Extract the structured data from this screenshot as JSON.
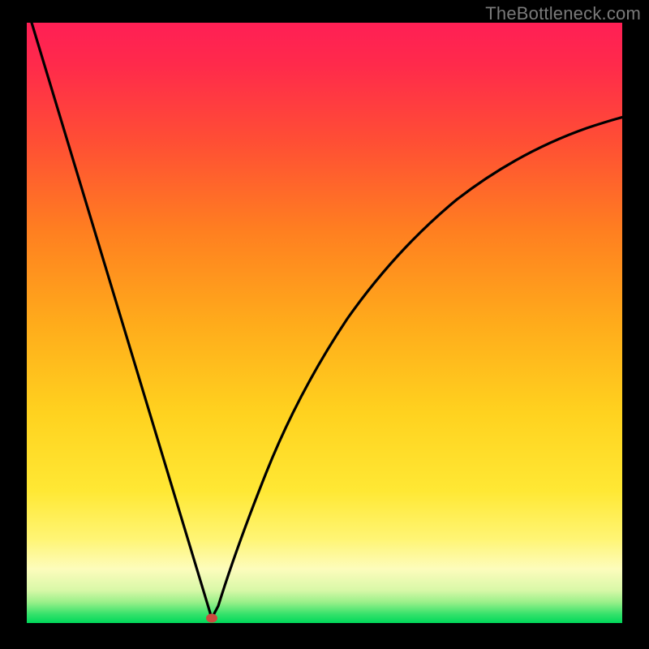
{
  "watermark": "TheBottleneck.com",
  "chart_data": {
    "type": "line",
    "title": "",
    "xlabel": "",
    "ylabel": "",
    "xlim": [
      0,
      100
    ],
    "ylim": [
      0,
      100
    ],
    "grid": false,
    "legend": false,
    "annotations": [],
    "background_gradient": {
      "top": "#ff1f4d",
      "mid_orange": "#ff7a1a",
      "yellow": "#ffe636",
      "pale_yellow": "#fff79a",
      "green": "#00e05a"
    },
    "marker": {
      "x": 31,
      "y": 0,
      "color": "#cc4a3f"
    },
    "series": [
      {
        "name": "bottleneck-curve",
        "x": [
          0,
          4,
          8,
          12,
          16,
          20,
          24,
          27,
          29,
          30,
          31,
          32,
          34,
          37,
          41,
          46,
          52,
          59,
          67,
          76,
          86,
          100
        ],
        "y": [
          100,
          87,
          74,
          61,
          48,
          35,
          22,
          12,
          5,
          2,
          0,
          3,
          10,
          22,
          35,
          47,
          56,
          64,
          70,
          75,
          79,
          82
        ]
      }
    ]
  }
}
